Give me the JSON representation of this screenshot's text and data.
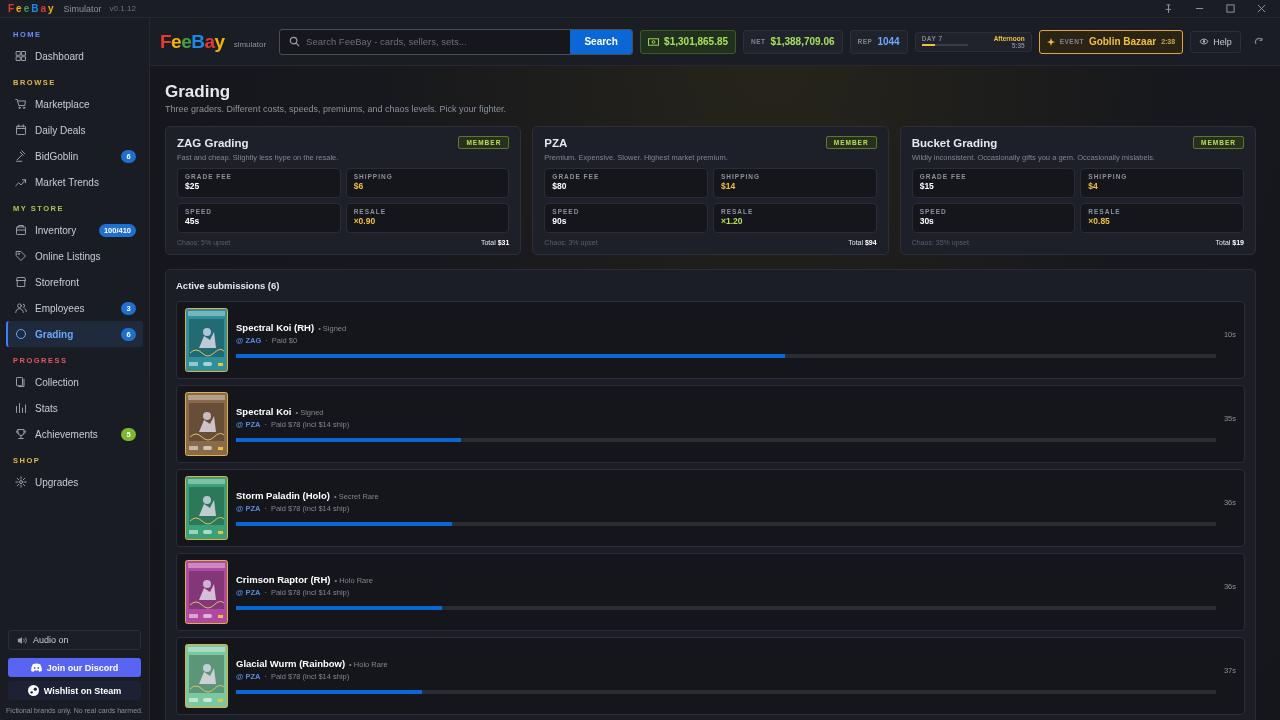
{
  "titlebar": {
    "logo": "FeeBay",
    "subtitle": "Simulator",
    "version": "v0.1.12"
  },
  "sidebar": {
    "sections": [
      {
        "title": "HOME",
        "color": "#6b8cff",
        "items": [
          {
            "label": "Dashboard",
            "selected": false
          }
        ]
      },
      {
        "title": "BROWSE",
        "color": "#e0b84a",
        "items": [
          {
            "label": "Marketplace",
            "selected": false
          },
          {
            "label": "Daily Deals",
            "selected": false
          },
          {
            "label": "BidGoblin",
            "selected": false,
            "badge": "6",
            "color": "#1f6fd1"
          },
          {
            "label": "Market Trends",
            "selected": false
          }
        ]
      },
      {
        "title": "MY STORE",
        "color": "#a6c94a",
        "items": [
          {
            "label": "Inventory",
            "selected": false,
            "badge": "100/410",
            "color": "#1f6fd1"
          },
          {
            "label": "Online Listings",
            "selected": false
          },
          {
            "label": "Storefront",
            "selected": false
          },
          {
            "label": "Employees",
            "selected": false,
            "badge": "3",
            "color": "#1f6fd1"
          },
          {
            "label": "Grading",
            "selected": true,
            "badge": "6",
            "color": "#1f6fd1"
          }
        ]
      },
      {
        "title": "PROGRESS",
        "color": "#e05a5a",
        "items": [
          {
            "label": "Collection",
            "selected": false
          },
          {
            "label": "Stats",
            "selected": false
          },
          {
            "label": "Achievements",
            "selected": false,
            "badge": "5",
            "color": "#7cb82f"
          }
        ]
      },
      {
        "title": "SHOP",
        "color": "#e0b84a",
        "items": [
          {
            "label": "Upgrades",
            "selected": false
          }
        ]
      }
    ],
    "audio": "Audio on",
    "discord": "Join our Discord",
    "steam": "Wishlist on Steam",
    "footer": "Fictional brands only. No real cards harmed."
  },
  "header": {
    "logo": "FeeBay",
    "logo_sub": "simulator",
    "search": {
      "placeholder": "Search FeeBay - cards, sellers, sets..."
    },
    "search_button": "Search",
    "cash": "$1,301,865.85",
    "net_label": "NET",
    "net": "$1,388,709.06",
    "rep_label": "REP",
    "rep": "1044",
    "day": "DAY 7",
    "phase": "Afternoon",
    "clock": "5:35",
    "day_progress": {
      "level": 0.3
    },
    "event_label": "EVENT",
    "event": "Goblin Bazaar",
    "event_time": "2:38",
    "help": "Help"
  },
  "page": {
    "title": "Grading",
    "subtitle": "Three graders. Different costs, speeds, premiums, and chaos levels. Pick your fighter."
  },
  "graders": [
    {
      "name": "ZAG Grading",
      "badge": "MEMBER",
      "description": "Fast and cheap. Slightly less hype on the resale.",
      "stats": [
        {
          "label": "GRADE FEE",
          "value": "$25",
          "color": "#ffffff"
        },
        {
          "label": "SHIPPING",
          "value": "$6",
          "color": "#f0c040"
        },
        {
          "label": "SPEED",
          "value": "45s",
          "color": "#ffffff"
        },
        {
          "label": "RESALE",
          "value": "×0.90",
          "color": "#f0c040"
        }
      ],
      "chaos": "Chaos: 5% upset",
      "total_label": "Total",
      "total": "$31"
    },
    {
      "name": "PZA",
      "badge": "MEMBER",
      "description": "Premium. Expensive. Slower. Highest market premium.",
      "stats": [
        {
          "label": "GRADE FEE",
          "value": "$80",
          "color": "#ffffff"
        },
        {
          "label": "SHIPPING",
          "value": "$14",
          "color": "#f0c040"
        },
        {
          "label": "SPEED",
          "value": "90s",
          "color": "#ffffff"
        },
        {
          "label": "RESALE",
          "value": "×1.20",
          "color": "#b8e05a"
        }
      ],
      "chaos": "Chaos: 3% upset",
      "total_label": "Total",
      "total": "$94"
    },
    {
      "name": "Bucket Grading",
      "badge": "MEMBER",
      "description": "Wildly inconsistent. Occasionally gifts you a gem. Occasionally mislabels.",
      "stats": [
        {
          "label": "GRADE FEE",
          "value": "$15",
          "color": "#ffffff"
        },
        {
          "label": "SHIPPING",
          "value": "$4",
          "color": "#f0c040"
        },
        {
          "label": "SPEED",
          "value": "30s",
          "color": "#ffffff"
        },
        {
          "label": "RESALE",
          "value": "×0.85",
          "color": "#f0c040"
        }
      ],
      "chaos": "Chaos: 35% upset",
      "total_label": "Total",
      "total": "$19"
    }
  ],
  "submissions": {
    "title": "Active submissions (6)",
    "items": [
      {
        "name": "Spectral Koi (RH)",
        "rarity": "• Signed",
        "grader": "@ ZAG",
        "divider": "·",
        "paid": "Paid $0",
        "time": "10s",
        "level": 0.56,
        "color": "#2f8f9a"
      },
      {
        "name": "Spectral Koi",
        "rarity": "• Signed",
        "grader": "@ PZA",
        "divider": "·",
        "paid": "Paid $78 (incl $14 ship)",
        "time": "35s",
        "level": 0.23,
        "color": "#8a6a4a"
      },
      {
        "name": "Storm Paladin (Holo)",
        "rarity": "• Secret Rare",
        "grader": "@ PZA",
        "divider": "·",
        "paid": "Paid $78 (incl $14 ship)",
        "time": "36s",
        "level": 0.22,
        "color": "#3aa07a"
      },
      {
        "name": "Crimson Raptor (RH)",
        "rarity": "• Holo Rare",
        "grader": "@ PZA",
        "divider": "·",
        "paid": "Paid $78 (incl $14 ship)",
        "time": "36s",
        "level": 0.21,
        "color": "#b04aa0"
      },
      {
        "name": "Glacial Wurm (Rainbow)",
        "rarity": "• Holo Rare",
        "grader": "@ PZA",
        "divider": "·",
        "paid": "Paid $78 (incl $14 ship)",
        "time": "37s",
        "level": 0.19,
        "color": "#7ac8a0"
      }
    ]
  }
}
